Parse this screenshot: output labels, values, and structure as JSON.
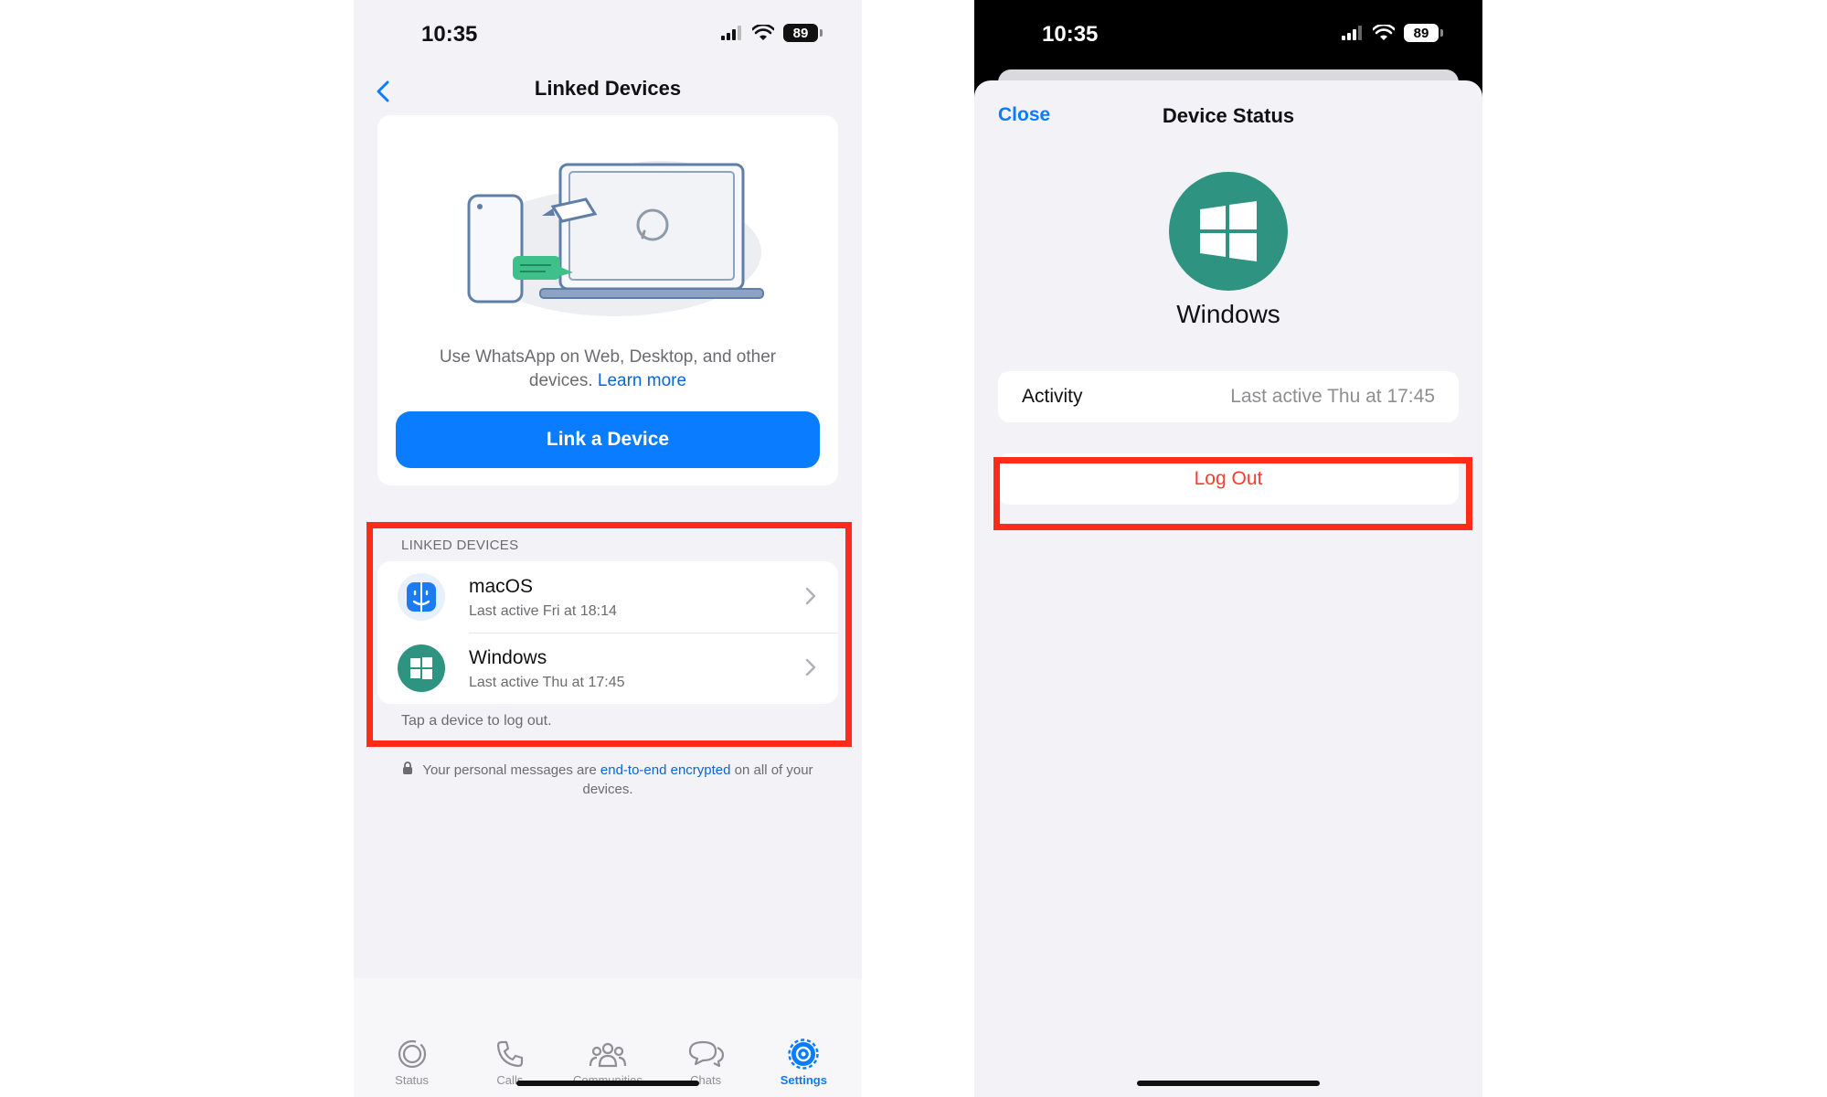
{
  "status_bar": {
    "time": "10:35",
    "battery": "89"
  },
  "left_screen": {
    "nav": {
      "title": "Linked Devices"
    },
    "hero": {
      "description": "Use WhatsApp on Web, Desktop, and other devices.",
      "learn_more": "Learn more",
      "button_label": "Link a Device"
    },
    "linked_devices": {
      "section_header": "LINKED DEVICES",
      "items": [
        {
          "name": "macOS",
          "last_active": "Last active Fri at 18:14",
          "icon": "macos-finder-icon"
        },
        {
          "name": "Windows",
          "last_active": "Last active Thu at 17:45",
          "icon": "windows-icon"
        }
      ],
      "footer": "Tap a device to log out."
    },
    "encryption_note": {
      "before": "Your personal messages are ",
      "link": "end-to-end encrypted",
      "after": " on all of your devices."
    },
    "tabbar": [
      {
        "label": "Status",
        "icon": "status-icon",
        "active": false
      },
      {
        "label": "Calls",
        "icon": "phone-icon",
        "active": false
      },
      {
        "label": "Communities",
        "icon": "communities-icon",
        "active": false
      },
      {
        "label": "Chats",
        "icon": "chats-icon",
        "active": false
      },
      {
        "label": "Settings",
        "icon": "settings-gear-icon",
        "active": true
      }
    ]
  },
  "right_screen": {
    "close_label": "Close",
    "title": "Device Status",
    "device_name": "Windows",
    "activity": {
      "label": "Activity",
      "value": "Last active Thu at 17:45"
    },
    "logout_label": "Log Out"
  },
  "colors": {
    "accent_blue": "#0a7cff",
    "highlight_red": "#ff2a1a",
    "windows_green": "#2e9481",
    "destructive_red": "#ff3b30",
    "background_grey": "#f2f2f7"
  }
}
